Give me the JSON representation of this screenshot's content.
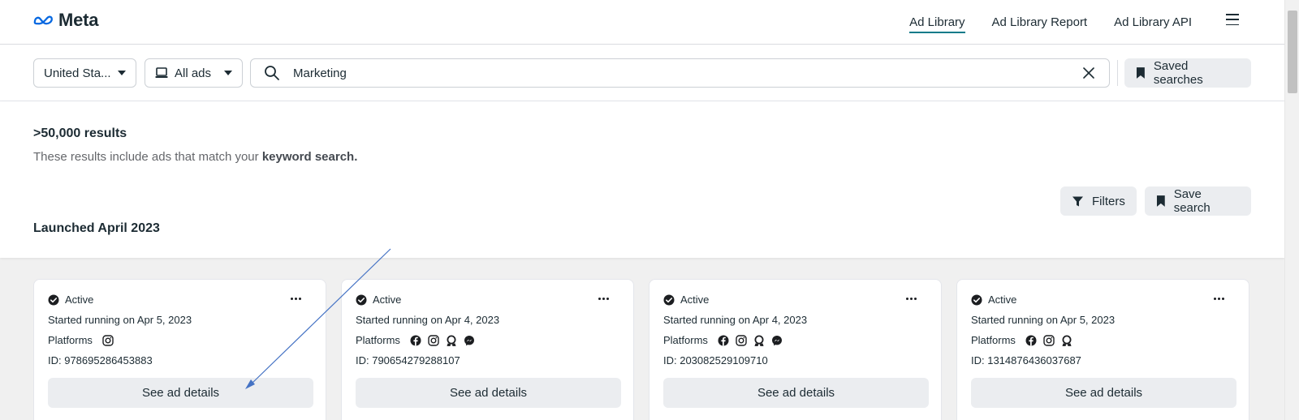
{
  "header": {
    "logo_text": "Meta",
    "nav": [
      {
        "label": "Ad Library",
        "active": true
      },
      {
        "label": "Ad Library Report",
        "active": false
      },
      {
        "label": "Ad Library API",
        "active": false
      }
    ]
  },
  "search": {
    "country": "United Sta...",
    "ad_type": "All ads",
    "query": "Marketing",
    "saved_searches_label": "Saved searches"
  },
  "results": {
    "count": ">50,000 results",
    "note_prefix": "These results include ads that match your ",
    "note_bold": "keyword search.",
    "filters_label": "Filters",
    "save_search_label": "Save search",
    "section_title": "Launched April 2023"
  },
  "cards": [
    {
      "status": "Active",
      "started": "Started running on Apr 5, 2023",
      "platforms_label": "Platforms",
      "platforms": [
        "instagram"
      ],
      "id": "ID: 978695286453883",
      "button": "See ad details"
    },
    {
      "status": "Active",
      "started": "Started running on Apr 4, 2023",
      "platforms_label": "Platforms",
      "platforms": [
        "facebook",
        "instagram",
        "audience-network",
        "messenger"
      ],
      "id": "ID: 790654279288107",
      "button": "See ad details"
    },
    {
      "status": "Active",
      "started": "Started running on Apr 4, 2023",
      "platforms_label": "Platforms",
      "platforms": [
        "facebook",
        "instagram",
        "audience-network",
        "messenger"
      ],
      "id": "ID: 203082529109710",
      "button": "See ad details"
    },
    {
      "status": "Active",
      "started": "Started running on Apr 5, 2023",
      "platforms_label": "Platforms",
      "platforms": [
        "facebook",
        "instagram",
        "audience-network"
      ],
      "id": "ID: 1314876436037687",
      "button": "See ad details"
    }
  ],
  "colors": {
    "accent_underline": "#0a7b8a",
    "annotation_arrow": "#4472c4",
    "meta_blue": "#0668e1"
  }
}
